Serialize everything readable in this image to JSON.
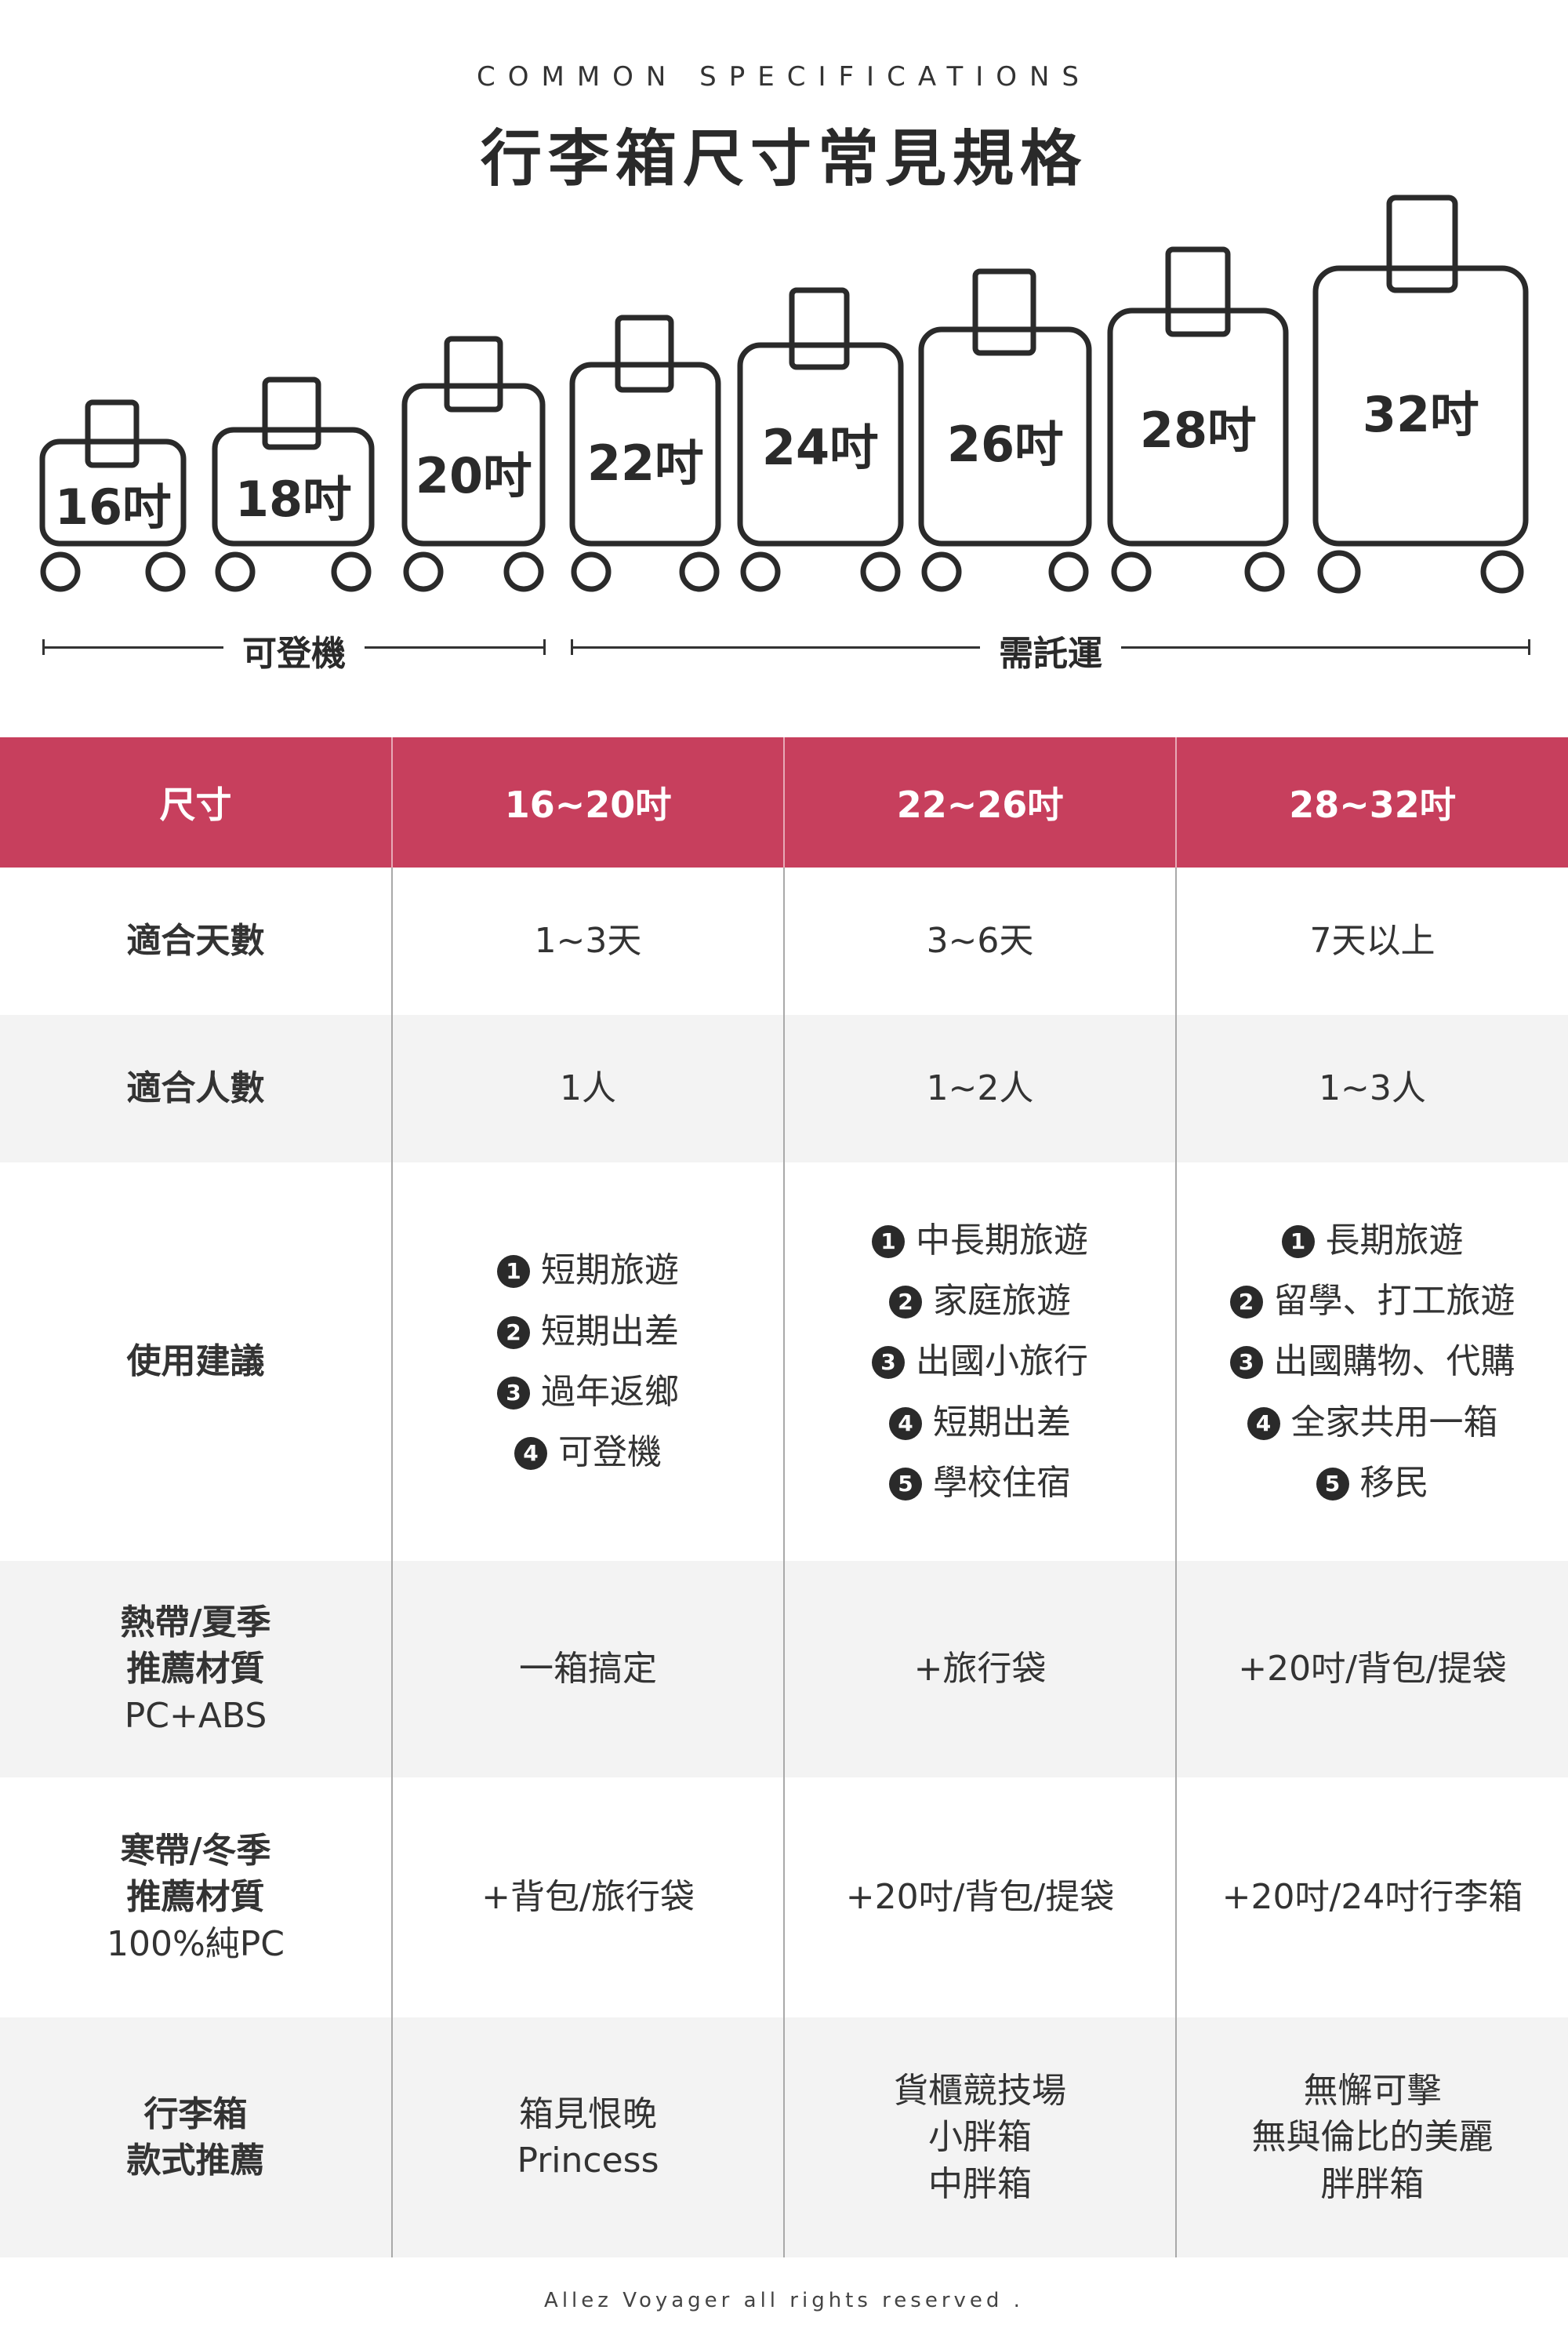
{
  "header": {
    "eyebrow": "COMMON SPECIFICATIONS",
    "title": "行李箱尺寸常見規格"
  },
  "suitcases": [
    "16吋",
    "18吋",
    "20吋",
    "22吋",
    "24吋",
    "26吋",
    "28吋",
    "32吋"
  ],
  "groups": {
    "carry_on": "可登機",
    "checked": "需託運"
  },
  "table": {
    "headers": [
      "尺寸",
      "16~20吋",
      "22~26吋",
      "28~32吋"
    ],
    "days": {
      "label": "適合天數",
      "values": [
        "1~3天",
        "3~6天",
        "7天以上"
      ]
    },
    "people": {
      "label": "適合人數",
      "values": [
        "1人",
        "1~2人",
        "1~3人"
      ]
    },
    "usage": {
      "label": "使用建議",
      "col1": [
        "短期旅遊",
        "短期出差",
        "過年返鄉",
        "可登機"
      ],
      "col2": [
        "中長期旅遊",
        "家庭旅遊",
        "出國小旅行",
        "短期出差",
        "學校住宿"
      ],
      "col3": [
        "長期旅遊",
        "留學、打工旅遊",
        "出國購物、代購",
        "全家共用一箱",
        "移民"
      ]
    },
    "tropical": {
      "label_lines": [
        "熱帶/夏季",
        "推薦材質",
        "PC+ABS"
      ],
      "values": [
        "一箱搞定",
        "+旅行袋",
        "+20吋/背包/提袋"
      ]
    },
    "cold": {
      "label_lines": [
        "寒帶/冬季",
        "推薦材質",
        "100%純PC"
      ],
      "values": [
        "+背包/旅行袋",
        "+20吋/背包/提袋",
        "+20吋/24吋行李箱"
      ]
    },
    "style": {
      "label_lines": [
        "行李箱",
        "款式推薦"
      ],
      "col1": [
        "箱見恨晚",
        "Princess"
      ],
      "col2": [
        "貨櫃競技場",
        "小胖箱",
        "中胖箱"
      ],
      "col3": [
        "無懈可擊",
        "無與倫比的美麗",
        "胖胖箱"
      ]
    }
  },
  "footer": "Allez Voyager all rights reserved ."
}
